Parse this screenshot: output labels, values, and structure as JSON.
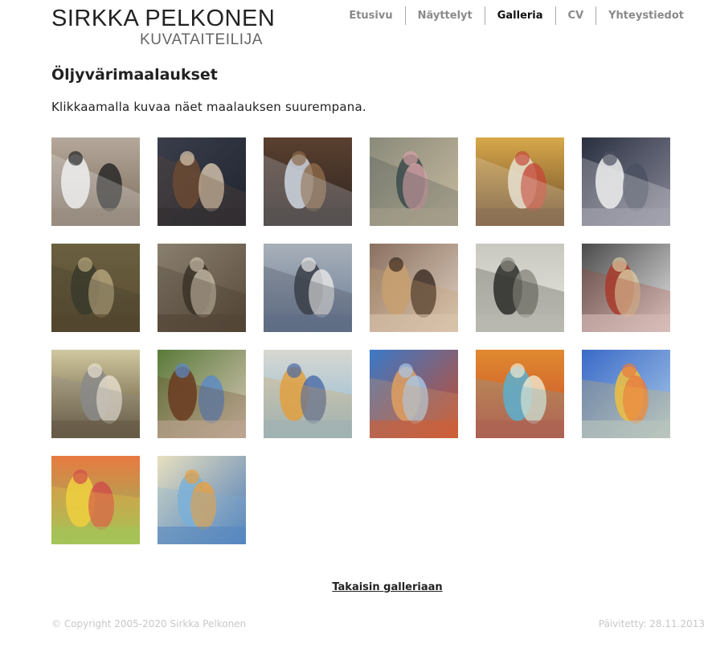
{
  "header": {
    "artist_name": "SIRKKA PELKONEN",
    "artist_title": "KUVATAITEILIJA"
  },
  "nav": {
    "items": [
      {
        "label": "Etusivu",
        "active": false
      },
      {
        "label": "Näyttelyt",
        "active": false
      },
      {
        "label": "Galleria",
        "active": true
      },
      {
        "label": "CV",
        "active": false
      },
      {
        "label": "Yhteystiedot",
        "active": false
      }
    ]
  },
  "main": {
    "title": "Öljyvärimaalaukset",
    "intro": "Klikkaamalla kuvaa näet maalauksen suurempana.",
    "thumbnails": [
      {
        "name": "painting-wedding-children-thumb",
        "colors": [
          "#b5a89a",
          "#eeeeee",
          "#222222",
          "#7a6a5a"
        ]
      },
      {
        "name": "painting-two-boys-thumb",
        "colors": [
          "#3a3e4a",
          "#6b4a33",
          "#d9c8b0",
          "#1e2430"
        ]
      },
      {
        "name": "painting-girl-in-room-thumb",
        "colors": [
          "#5a4030",
          "#cfd6e2",
          "#8c6a48",
          "#2e2420"
        ]
      },
      {
        "name": "painting-mother-children-thumb",
        "colors": [
          "#8a8a7a",
          "#3a4a4a",
          "#d7a3a6",
          "#c9bba0"
        ]
      },
      {
        "name": "painting-girls-yard-thumb",
        "colors": [
          "#d8a84a",
          "#e8e0d0",
          "#c44a3a",
          "#6a4a2a"
        ]
      },
      {
        "name": "painting-man-white-shirt-thumb",
        "colors": [
          "#2a3040",
          "#eeeeee",
          "#4a5060",
          "#8a8a9a"
        ]
      },
      {
        "name": "painting-field-workers-thumb",
        "colors": [
          "#6a6040",
          "#3a3a2a",
          "#b8a880",
          "#5a4a30"
        ]
      },
      {
        "name": "painting-old-machines-thumb",
        "colors": [
          "#8a8070",
          "#3a3228",
          "#c8bca8",
          "#5a4a3a"
        ]
      },
      {
        "name": "painting-kitchen-women-thumb",
        "colors": [
          "#a8b0b8",
          "#3a4048",
          "#e8e8e8",
          "#6a7c9a"
        ]
      },
      {
        "name": "painting-old-woman-thumb",
        "colors": [
          "#8a7060",
          "#c8a070",
          "#3a2a20",
          "#e0d0c0"
        ]
      },
      {
        "name": "painting-winter-work-thumb",
        "colors": [
          "#c8c8c0",
          "#2a2a28",
          "#8a8a80",
          "#e8e8e0"
        ]
      },
      {
        "name": "painting-woman-by-stove-thumb",
        "colors": [
          "#4a4a4a",
          "#a83a2a",
          "#d8c8a0",
          "#e8e8e8"
        ]
      },
      {
        "name": "painting-boy-at-desk-thumb",
        "colors": [
          "#d0c8a0",
          "#8a8a8a",
          "#e8e0d0",
          "#5a4a30"
        ]
      },
      {
        "name": "painting-blue-chair-thumb",
        "colors": [
          "#5a7a3a",
          "#6a3a20",
          "#5a8ac8",
          "#d8c8b8"
        ]
      },
      {
        "name": "painting-abstract-spheres-thumb",
        "colors": [
          "#d8d8d0",
          "#e0a040",
          "#4a6aa8",
          "#8ab8d8"
        ]
      },
      {
        "name": "painting-abstract-target-thumb",
        "colors": [
          "#3a7ac8",
          "#e0a060",
          "#a8c8e8",
          "#c84a2a"
        ]
      },
      {
        "name": "painting-abstract-eye-thumb",
        "colors": [
          "#e08a30",
          "#5ab0d0",
          "#f0e8d0",
          "#c84a2a"
        ]
      },
      {
        "name": "painting-abstract-light-thumb",
        "colors": [
          "#3a6ac8",
          "#f0c040",
          "#e87a40",
          "#a8c8e8"
        ]
      },
      {
        "name": "painting-abstract-sunset-thumb",
        "colors": [
          "#e87a40",
          "#f0d040",
          "#d04a4a",
          "#8ac060"
        ]
      },
      {
        "name": "painting-abstract-sailboats-thumb",
        "colors": [
          "#e8e0c0",
          "#7ab0d8",
          "#e8a040",
          "#4a7ab8"
        ]
      }
    ]
  },
  "back_link": "Takaisin galleriaan",
  "footer": {
    "copyright": "© Copyright 2005-2020 Sirkka Pelkonen",
    "updated": "Päivitetty: 28.11.2013"
  }
}
